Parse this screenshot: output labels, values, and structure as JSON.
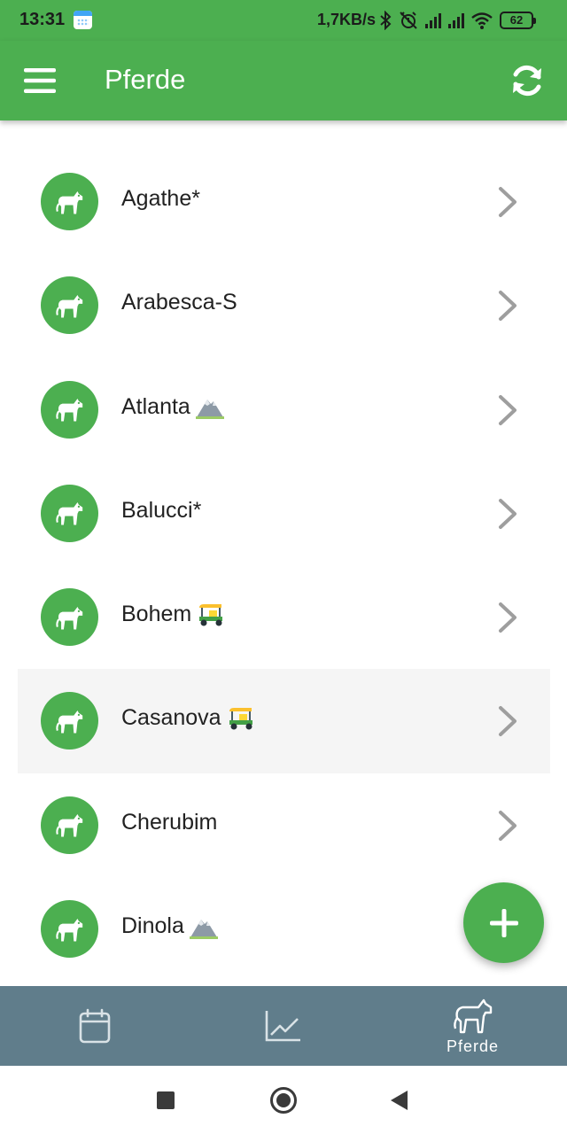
{
  "status_bar": {
    "time": "13:31",
    "network_speed": "1,7KB/s",
    "battery": "62",
    "icons": [
      "calendar-icon",
      "bluetooth-icon",
      "alarm-off-icon",
      "signal-icon",
      "signal-icon",
      "wifi-icon",
      "battery-icon"
    ]
  },
  "app_bar": {
    "title": "Pferde",
    "left_icon": "menu-icon",
    "right_icon": "refresh-icon"
  },
  "horses": [
    {
      "name": "Agathe*",
      "emoji": ""
    },
    {
      "name": "Arabesca-S",
      "emoji": ""
    },
    {
      "name": "Atlanta",
      "emoji": "mountain"
    },
    {
      "name": "Balucci*",
      "emoji": ""
    },
    {
      "name": "Bohem",
      "emoji": "auto-rickshaw"
    },
    {
      "name": "Casanova",
      "emoji": "auto-rickshaw",
      "highlighted": true
    },
    {
      "name": "Cherubim",
      "emoji": ""
    },
    {
      "name": "Dinola",
      "emoji": "mountain"
    }
  ],
  "fab": {
    "icon": "plus-icon"
  },
  "bottom_nav": {
    "items": [
      {
        "icon": "calendar-icon",
        "label": ""
      },
      {
        "icon": "chart-icon",
        "label": ""
      },
      {
        "icon": "horse-icon",
        "label": "Pferde",
        "active": true
      }
    ]
  },
  "colors": {
    "primary": "#4caf50",
    "bottom_nav": "#607d8b",
    "highlight_row": "#f5f5f5",
    "chevron": "#9e9e9e"
  }
}
